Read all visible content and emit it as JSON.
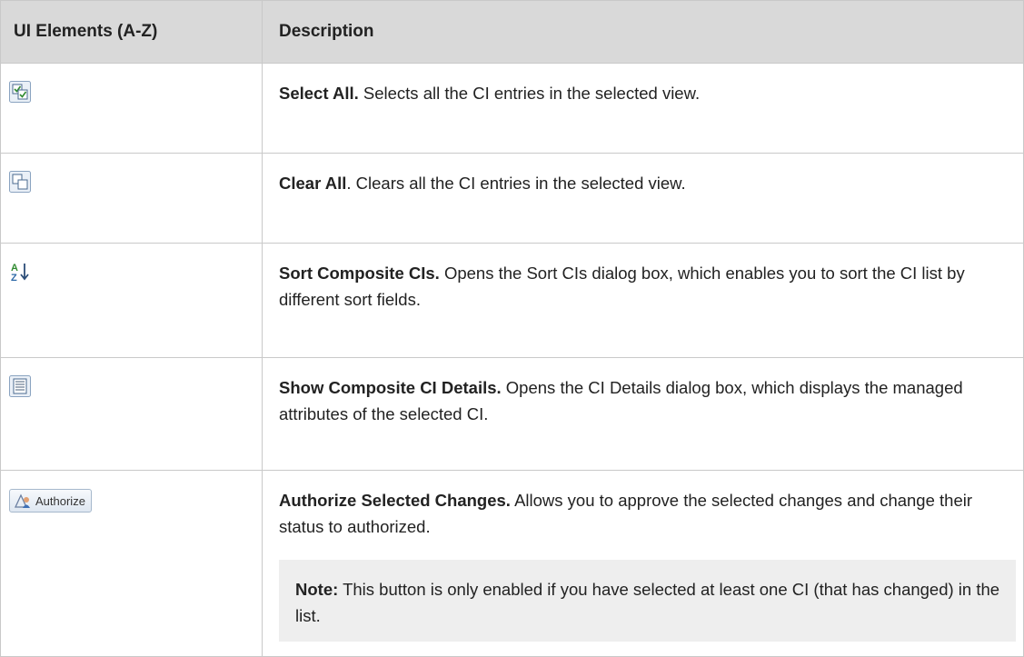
{
  "header": {
    "col1": "UI Elements (A-Z)",
    "col2": "Description"
  },
  "rows": [
    {
      "icon": "select-all-icon",
      "title": "Select All.",
      "text": " Selects all the CI entries in the selected view."
    },
    {
      "icon": "clear-all-icon",
      "title": "Clear All",
      "text": ". Clears all the CI entries in the selected view."
    },
    {
      "icon": "sort-az-icon",
      "title": "Sort Composite CIs.",
      "text": " Opens the Sort CIs dialog box, which enables you to sort the CI list by different sort fields."
    },
    {
      "icon": "details-icon",
      "title": "Show Composite CI Details.",
      "text": " Opens the CI Details dialog box, which displays the managed attributes of the selected CI."
    },
    {
      "icon": "authorize-icon",
      "button_label": "Authorize",
      "title": "Authorize Selected Changes.",
      "text": " Allows you to approve the selected changes and change their status to authorized.",
      "note_label": "Note:",
      "note_text": " This button is only enabled if you have selected at least one CI (that has changed) in the list."
    }
  ]
}
